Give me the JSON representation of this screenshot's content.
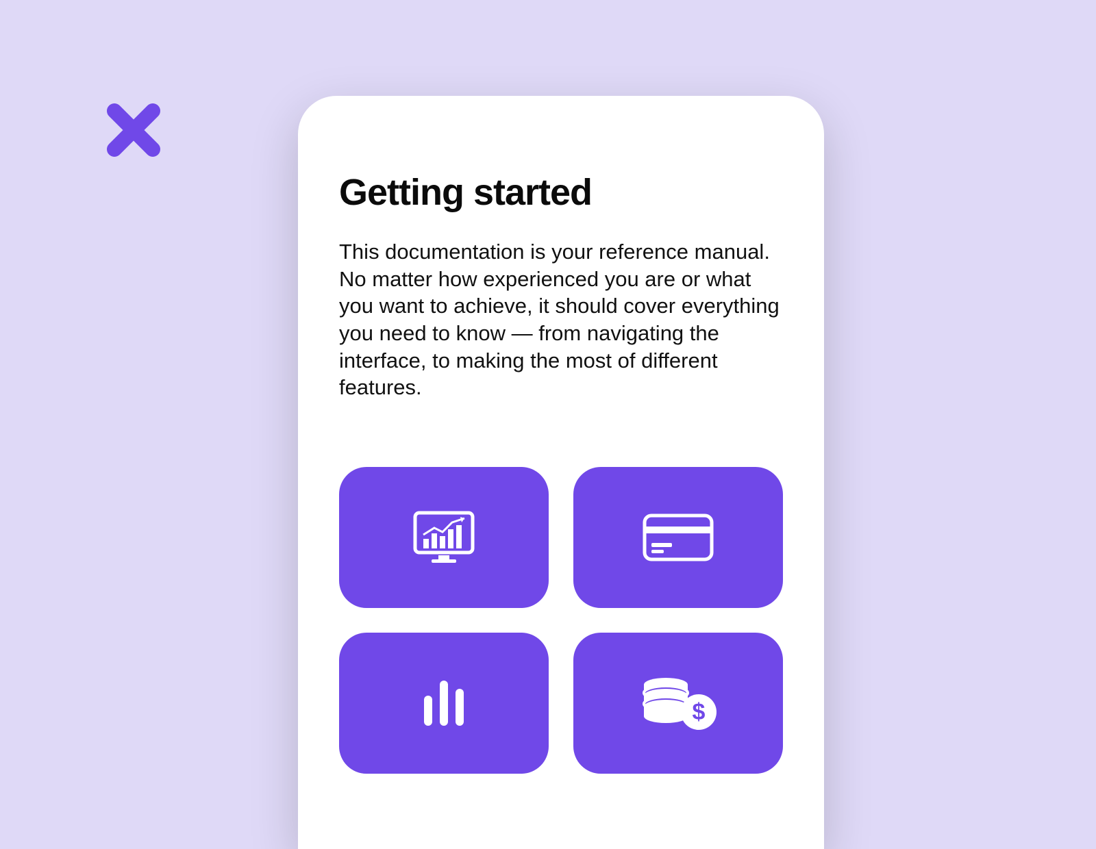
{
  "colors": {
    "page_bg": "#DFD9F7",
    "accent": "#7048E8",
    "card_bg": "#FFFFFF",
    "text": "#0B0B0B"
  },
  "close_icon": "x-icon",
  "card": {
    "title": "Getting started",
    "description": "This documentation is your reference manual. No matter how experienced you are or what you want to achieve, it should cover everything you need to know — from navigating the interface, to making the most of different features.",
    "tiles": [
      {
        "icon": "analytics-monitor-icon"
      },
      {
        "icon": "credit-card-icon"
      },
      {
        "icon": "bar-chart-icon"
      },
      {
        "icon": "coins-dollar-icon"
      }
    ]
  }
}
